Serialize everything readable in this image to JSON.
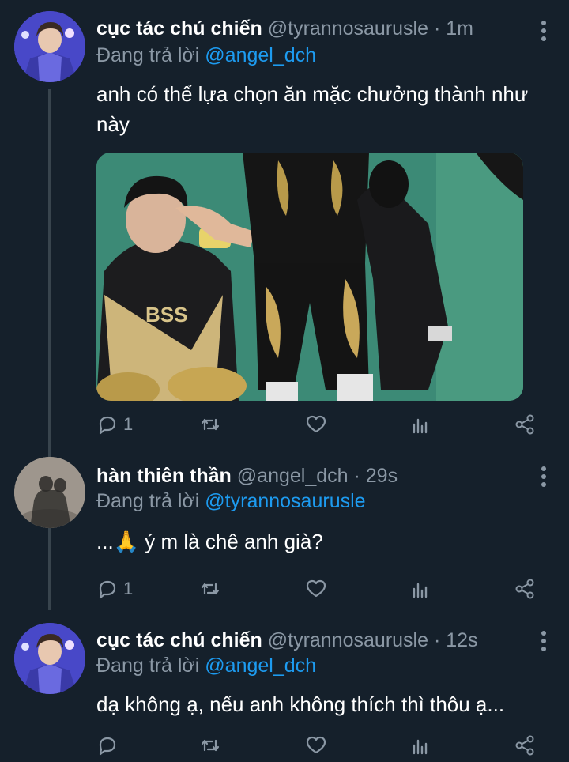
{
  "tweets": [
    {
      "name": "cục tác chú chiến",
      "handle": "@tyrannosaurusle",
      "dot": "·",
      "time": "1m",
      "reply_prefix": "Đang trả lời",
      "reply_to": "@angel_dch",
      "text": "anh có thể lựa chọn ăn mặc chưởng thành như này",
      "reply_count": "1",
      "media_text": "BSS"
    },
    {
      "name": "hàn thiên thần",
      "handle": "@angel_dch",
      "dot": "·",
      "time": "29s",
      "reply_prefix": "Đang trả lời",
      "reply_to": "@tyrannosaurusle",
      "text": "...🙏 ý m là chê anh già?",
      "reply_count": "1"
    },
    {
      "name": "cục tác chú chiến",
      "handle": "@tyrannosaurusle",
      "dot": "·",
      "time": "12s",
      "reply_prefix": "Đang trả lời",
      "reply_to": "@angel_dch",
      "text": "dạ không ạ, nếu anh không thích thì thôu ạ...",
      "reply_count": ""
    }
  ],
  "colors": {
    "background": "#15202b",
    "secondary_text": "#8b98a5",
    "mention": "#1d9bf0",
    "thread_line": "#38444d"
  },
  "icons": [
    "reply-icon",
    "retweet-icon",
    "like-icon",
    "analytics-icon",
    "share-icon",
    "more-icon"
  ]
}
